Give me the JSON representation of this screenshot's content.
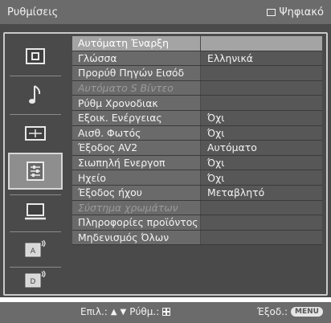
{
  "header": {
    "title": "Ρυθμίσεις",
    "source_label": "Ψηφιακό"
  },
  "sidebar": {
    "items": [
      {
        "icon": "picture-icon",
        "selected": false
      },
      {
        "icon": "sound-icon",
        "selected": false
      },
      {
        "icon": "screen-icon",
        "selected": false
      },
      {
        "icon": "setup-icon",
        "selected": true
      },
      {
        "icon": "pc-icon",
        "selected": false
      },
      {
        "icon": "analog-settings-icon",
        "selected": false
      },
      {
        "icon": "digital-settings-icon",
        "selected": false
      }
    ]
  },
  "menu": {
    "rows": [
      {
        "label": "Αυτόματη Έναρξη",
        "value": "",
        "state": "selected"
      },
      {
        "label": "Γλώσσα",
        "value": "Ελληνικά",
        "state": "normal"
      },
      {
        "label": "Προρύθ Πηγών Εισόδ",
        "value": "",
        "state": "normal"
      },
      {
        "label": "Αυτόματο S Βίντεο",
        "value": "",
        "state": "disabled"
      },
      {
        "label": "Ρύθμ Χρονοδιακ",
        "value": "",
        "state": "normal"
      },
      {
        "label": "Εξοικ. Ενέργειας",
        "value": "Όχι",
        "state": "normal"
      },
      {
        "label": "Αισθ. Φωτός",
        "value": "Όχι",
        "state": "normal"
      },
      {
        "label": "Έξοδος AV2",
        "value": "Αυτόματο",
        "state": "normal"
      },
      {
        "label": "Σιωπηλή Ενεργοπ",
        "value": "Όχι",
        "state": "normal"
      },
      {
        "label": "Ηχείο",
        "value": "Όχι",
        "state": "normal"
      },
      {
        "label": "Έξοδος ήχου",
        "value": "Μεταβλητό",
        "state": "normal"
      },
      {
        "label": "Σύστημα χρωμάτων",
        "value": "",
        "state": "disabled"
      },
      {
        "label": "Πληροφορίες προϊόντος",
        "value": "",
        "state": "normal"
      },
      {
        "label": "Μηδενισμός Όλων",
        "value": "",
        "state": "normal"
      }
    ]
  },
  "footer": {
    "select_label": "Επιλ.:",
    "set_label": "Ρύθμ.:",
    "exit_label": "Έξοδ.:",
    "menu_button": "MENU"
  }
}
